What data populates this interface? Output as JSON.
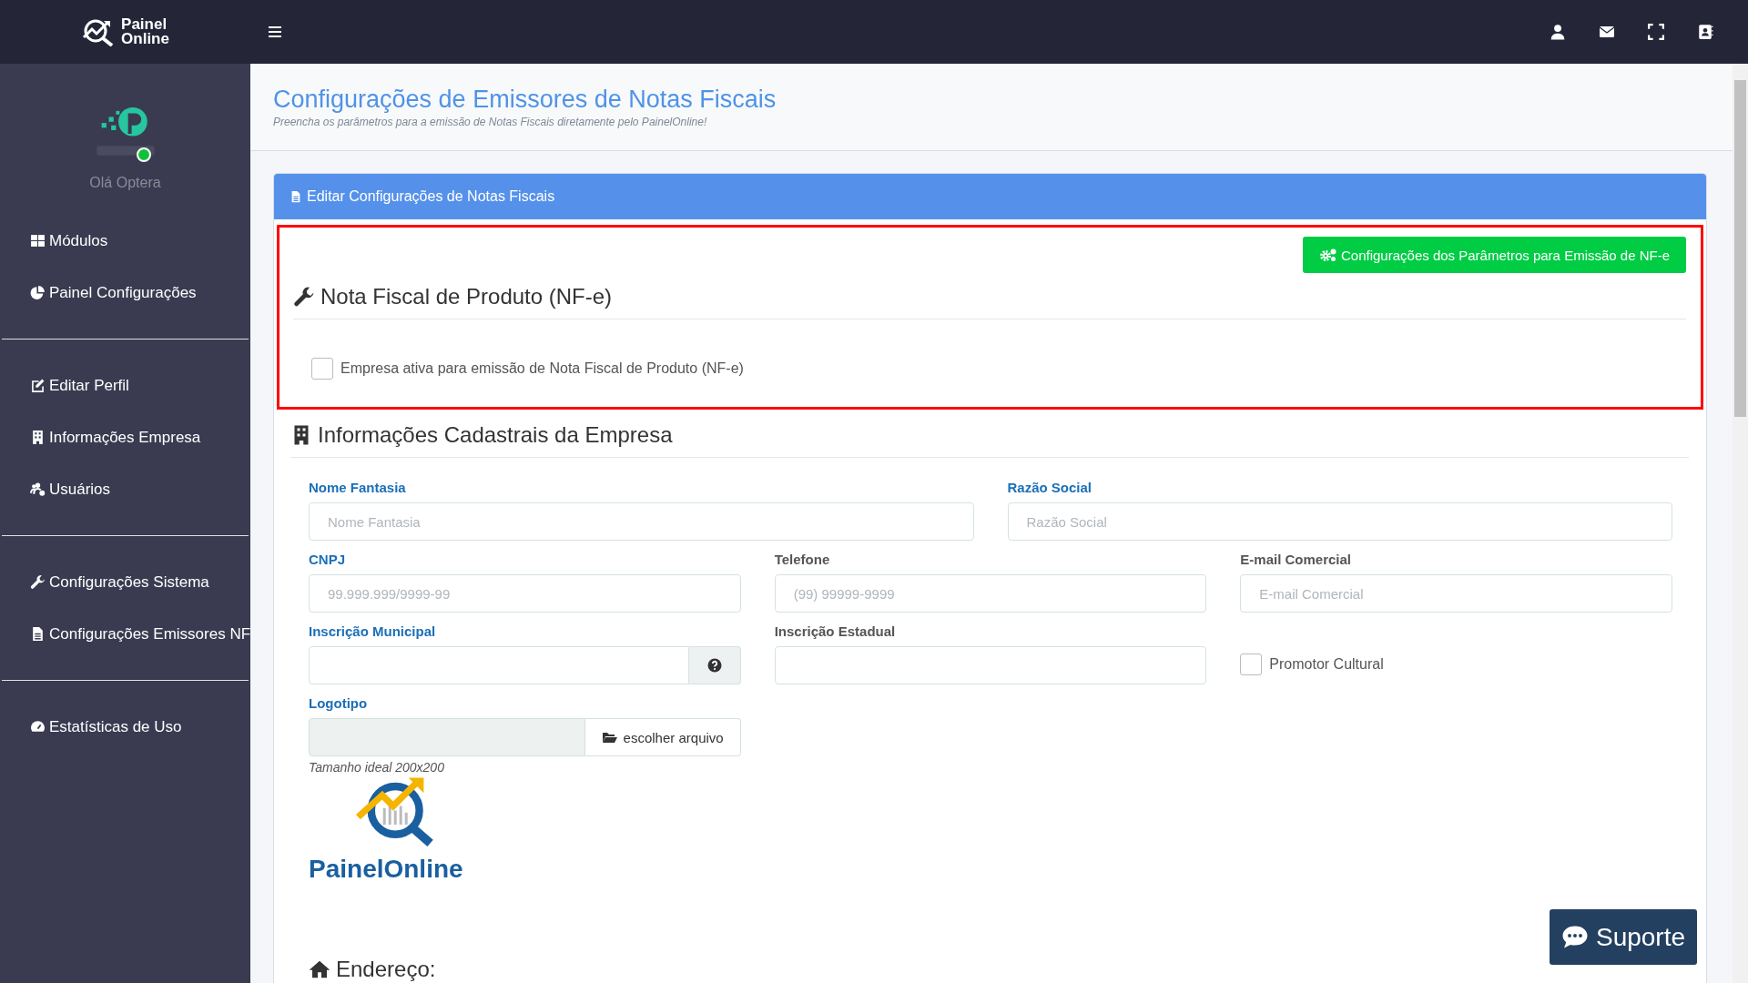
{
  "topbar": {
    "brand_lines": [
      "Painel",
      "Online"
    ]
  },
  "sidebar": {
    "user": {
      "greeting": "Olá Optera",
      "online": true
    },
    "groups": [
      [
        {
          "label": "Módulos"
        },
        {
          "label": "Painel Configurações"
        }
      ],
      [
        {
          "label": "Editar Perfil"
        },
        {
          "label": "Informações Empresa"
        },
        {
          "label": "Usuários"
        }
      ],
      [
        {
          "label": "Configurações Sistema"
        },
        {
          "label": "Configurações Emissores NF"
        }
      ],
      [
        {
          "label": "Estatísticas de Uso"
        }
      ]
    ]
  },
  "page": {
    "title": "Configurações de Emissores de Notas Fiscais",
    "subtitle": "Preencha os parâmetros para a emissão de Notas Fiscais diretamente pelo PainelOnline!"
  },
  "card": {
    "header": "Editar Configurações de Notas Fiscais",
    "nfe_section": {
      "highlighted": true,
      "button": "Configurações dos Parâmetros para Emissão de NF-e",
      "heading": "Nota Fiscal de Produto (NF-e)",
      "checkbox": {
        "label": "Empresa ativa para emissão de Nota Fiscal de Produto (NF-e)",
        "checked": false
      }
    },
    "company_section": {
      "heading": "Informações Cadastrais da Empresa",
      "rows": [
        {
          "fields": [
            {
              "kind": "text",
              "label": "Nome Fantasia",
              "required": true,
              "placeholder": "Nome Fantasia"
            },
            {
              "kind": "text",
              "label": "Razão Social",
              "required": true,
              "placeholder": "Razão Social"
            }
          ]
        },
        {
          "fields": [
            {
              "kind": "text",
              "label": "CNPJ",
              "required": true,
              "placeholder": "99.999.999/9999-99"
            },
            {
              "kind": "text",
              "label": "Telefone",
              "required": false,
              "placeholder": "(99) 99999-9999"
            },
            {
              "kind": "text",
              "label": "E-mail Comercial",
              "required": false,
              "placeholder": "E-mail Comercial"
            }
          ]
        },
        {
          "fields": [
            {
              "kind": "help",
              "label": "Inscrição Municipal",
              "required": true
            },
            {
              "kind": "text",
              "label": "Inscrição Estadual",
              "required": false
            },
            {
              "kind": "checkbox",
              "label": "Promotor Cultural",
              "checked": false
            }
          ]
        },
        {
          "fields": [
            {
              "kind": "file",
              "label": "Logotipo",
              "required": true,
              "button": "escolher arquivo",
              "hint": "Tamanho ideal 200x200",
              "logo_text": "PainelOnline"
            }
          ]
        }
      ]
    },
    "address_heading": "Endereço:"
  },
  "support_button": "Suporte"
}
